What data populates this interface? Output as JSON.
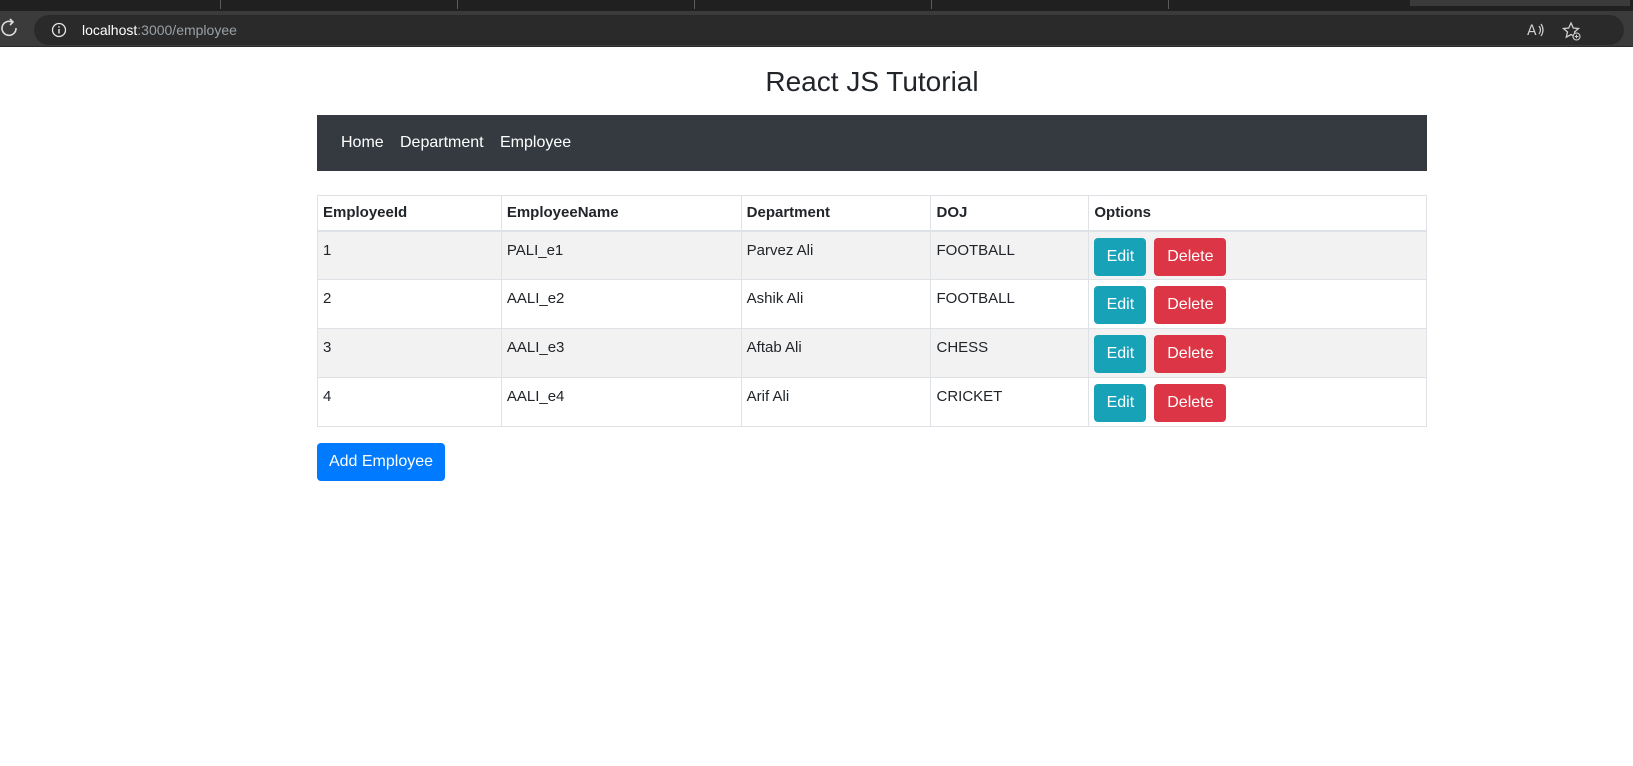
{
  "browser": {
    "url_host": "localhost",
    "url_path": ":3000/employee"
  },
  "page": {
    "title": "React JS Tutorial"
  },
  "nav": {
    "items": [
      {
        "label": "Home"
      },
      {
        "label": "Department"
      },
      {
        "label": "Employee"
      }
    ]
  },
  "table": {
    "headers": [
      "EmployeeId",
      "EmployeeName",
      "Department",
      "DOJ",
      "Options"
    ],
    "rows": [
      {
        "id": "1",
        "name": "PALI_e1",
        "department": "Parvez Ali",
        "doj": "FOOTBALL"
      },
      {
        "id": "2",
        "name": "AALI_e2",
        "department": "Ashik Ali",
        "doj": "FOOTBALL"
      },
      {
        "id": "3",
        "name": "AALI_e3",
        "department": "Aftab Ali",
        "doj": "CHESS"
      },
      {
        "id": "4",
        "name": "AALI_e4",
        "department": "Arif Ali",
        "doj": "CRICKET"
      }
    ],
    "edit_label": "Edit",
    "delete_label": "Delete"
  },
  "actions": {
    "add_label": "Add Employee"
  },
  "colors": {
    "navbar": "#343a40",
    "edit": "#17a2b8",
    "delete": "#dc3545",
    "primary": "#007bff"
  }
}
